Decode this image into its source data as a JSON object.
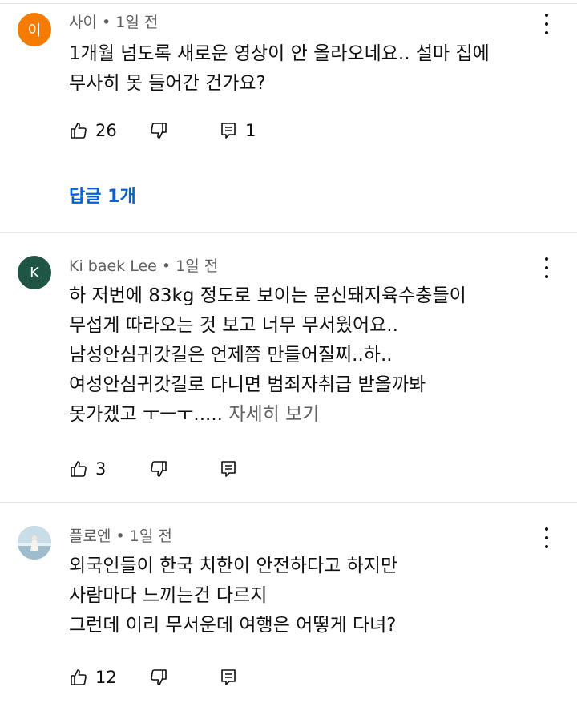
{
  "comments": [
    {
      "avatar_text": "이",
      "avatar_color": "#f57c00",
      "author": "사이",
      "time": "1일 전",
      "lines": [
        "1개월 넘도록 새로운 영상이 안 올라오네요.. 설마 집에",
        "무사히 못 들어간 건가요?"
      ],
      "likes": "26",
      "replies_count": "1",
      "reply_link": "답글 1개"
    },
    {
      "avatar_text": "K",
      "avatar_color": "#1e5545",
      "author": "Ki baek Lee",
      "time": "1일 전",
      "lines": [
        "하 저번에  83kg 정도로 보이는 문신돼지육수충들이",
        "무섭게 따라오는 것 보고 너무 무서웠어요..",
        "남성안심귀갓길은 언제쯤 만들어질찌..하..",
        "여성안심귀갓길로 다니면 범죄자취급 받을까봐",
        "못가겠고 ㅜㅡㅜ....."
      ],
      "read_more": "자세히 보기",
      "likes": "3"
    },
    {
      "avatar_color": "#a9c7d8",
      "author": "플로엔",
      "time": "1일 전",
      "lines": [
        "외국인들이 한국 치한이 안전하다고 하지만",
        "사람마다 느끼는건 다르지",
        "그런데 이리 무서운데 여행은 어떻게 다녀?"
      ],
      "likes": "12"
    }
  ],
  "separator": "•"
}
